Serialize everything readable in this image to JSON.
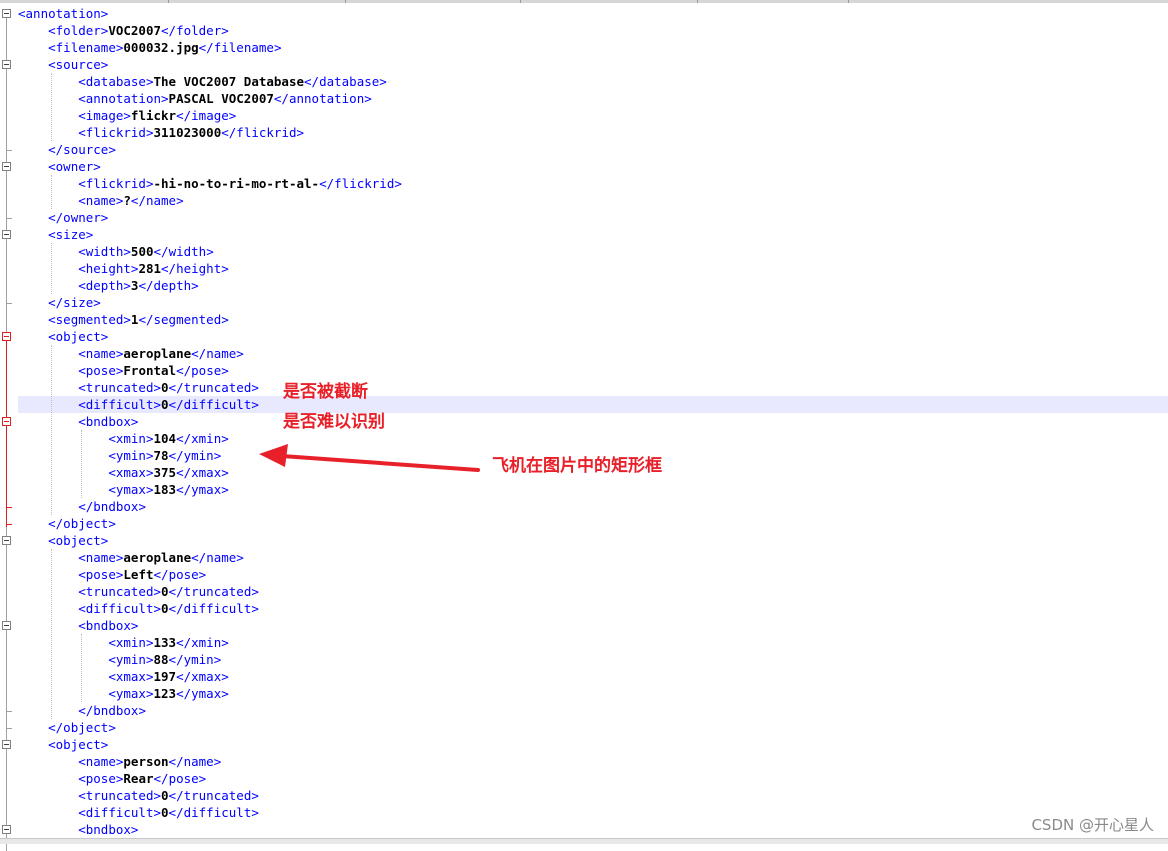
{
  "editor": {
    "lines": [
      {
        "indent": 0,
        "open": "annotation",
        "text": "",
        "close": ""
      },
      {
        "indent": 1,
        "open": "folder",
        "text": "VOC2007",
        "close": "folder"
      },
      {
        "indent": 1,
        "open": "filename",
        "text": "000032.jpg",
        "close": "filename"
      },
      {
        "indent": 1,
        "open": "source",
        "text": "",
        "close": ""
      },
      {
        "indent": 2,
        "open": "database",
        "text": "The VOC2007 Database",
        "close": "database"
      },
      {
        "indent": 2,
        "open": "annotation",
        "text": "PASCAL VOC2007",
        "close": "annotation"
      },
      {
        "indent": 2,
        "open": "image",
        "text": "flickr",
        "close": "image"
      },
      {
        "indent": 2,
        "open": "flickrid",
        "text": "311023000",
        "close": "flickrid"
      },
      {
        "indent": 1,
        "open": "/source",
        "text": "",
        "close": ""
      },
      {
        "indent": 1,
        "open": "owner",
        "text": "",
        "close": ""
      },
      {
        "indent": 2,
        "open": "flickrid",
        "text": "-hi-no-to-ri-mo-rt-al-",
        "close": "flickrid"
      },
      {
        "indent": 2,
        "open": "name",
        "text": "?",
        "close": "name"
      },
      {
        "indent": 1,
        "open": "/owner",
        "text": "",
        "close": ""
      },
      {
        "indent": 1,
        "open": "size",
        "text": "",
        "close": ""
      },
      {
        "indent": 2,
        "open": "width",
        "text": "500",
        "close": "width"
      },
      {
        "indent": 2,
        "open": "height",
        "text": "281",
        "close": "height"
      },
      {
        "indent": 2,
        "open": "depth",
        "text": "3",
        "close": "depth"
      },
      {
        "indent": 1,
        "open": "/size",
        "text": "",
        "close": ""
      },
      {
        "indent": 1,
        "open": "segmented",
        "text": "1",
        "close": "segmented"
      },
      {
        "indent": 1,
        "open": "object",
        "text": "",
        "close": ""
      },
      {
        "indent": 2,
        "open": "name",
        "text": "aeroplane",
        "close": "name"
      },
      {
        "indent": 2,
        "open": "pose",
        "text": "Frontal",
        "close": "pose"
      },
      {
        "indent": 2,
        "open": "truncated",
        "text": "0",
        "close": "truncated"
      },
      {
        "indent": 2,
        "open": "difficult",
        "text": "0",
        "close": "difficult"
      },
      {
        "indent": 2,
        "open": "bndbox",
        "text": "",
        "close": ""
      },
      {
        "indent": 3,
        "open": "xmin",
        "text": "104",
        "close": "xmin"
      },
      {
        "indent": 3,
        "open": "ymin",
        "text": "78",
        "close": "ymin"
      },
      {
        "indent": 3,
        "open": "xmax",
        "text": "375",
        "close": "xmax"
      },
      {
        "indent": 3,
        "open": "ymax",
        "text": "183",
        "close": "ymax"
      },
      {
        "indent": 2,
        "open": "/bndbox",
        "text": "",
        "close": ""
      },
      {
        "indent": 1,
        "open": "/object",
        "text": "",
        "close": ""
      },
      {
        "indent": 1,
        "open": "object",
        "text": "",
        "close": ""
      },
      {
        "indent": 2,
        "open": "name",
        "text": "aeroplane",
        "close": "name"
      },
      {
        "indent": 2,
        "open": "pose",
        "text": "Left",
        "close": "pose"
      },
      {
        "indent": 2,
        "open": "truncated",
        "text": "0",
        "close": "truncated"
      },
      {
        "indent": 2,
        "open": "difficult",
        "text": "0",
        "close": "difficult"
      },
      {
        "indent": 2,
        "open": "bndbox",
        "text": "",
        "close": ""
      },
      {
        "indent": 3,
        "open": "xmin",
        "text": "133",
        "close": "xmin"
      },
      {
        "indent": 3,
        "open": "ymin",
        "text": "88",
        "close": "ymin"
      },
      {
        "indent": 3,
        "open": "xmax",
        "text": "197",
        "close": "xmax"
      },
      {
        "indent": 3,
        "open": "ymax",
        "text": "123",
        "close": "ymax"
      },
      {
        "indent": 2,
        "open": "/bndbox",
        "text": "",
        "close": ""
      },
      {
        "indent": 1,
        "open": "/object",
        "text": "",
        "close": ""
      },
      {
        "indent": 1,
        "open": "object",
        "text": "",
        "close": ""
      },
      {
        "indent": 2,
        "open": "name",
        "text": "person",
        "close": "name"
      },
      {
        "indent": 2,
        "open": "pose",
        "text": "Rear",
        "close": "pose"
      },
      {
        "indent": 2,
        "open": "truncated",
        "text": "0",
        "close": "truncated"
      },
      {
        "indent": 2,
        "open": "difficult",
        "text": "0",
        "close": "difficult"
      },
      {
        "indent": 2,
        "open": "bndbox",
        "text": "",
        "close": ""
      }
    ]
  },
  "annotations": {
    "truncated_note": "是否被截断",
    "difficult_note": "是否难以识别",
    "bbox_note": "飞机在图片中的矩形框"
  },
  "watermark": "CSDN @开心星人",
  "colors": {
    "tag": "#0000ff",
    "text": "#000000",
    "annotation": "#e8202a",
    "highlight_line": "#e8e8ff"
  }
}
